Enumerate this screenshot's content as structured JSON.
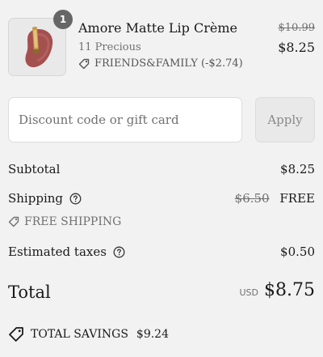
{
  "line_item": {
    "quantity": "1",
    "name": "Amore Matte Lip Crème",
    "variant": "11 Precious",
    "discount_label": "FRIENDS&FAMILY (-$2.74)",
    "original_price": "$10.99",
    "price": "$8.25",
    "image_icon": "lip-cream-product-icon"
  },
  "discount": {
    "placeholder": "Discount code or gift card",
    "apply_label": "Apply"
  },
  "summary": {
    "subtotal_label": "Subtotal",
    "subtotal_value": "$8.25",
    "shipping_label": "Shipping",
    "shipping_original": "$6.50",
    "shipping_value": "FREE",
    "free_shipping_label": "FREE SHIPPING",
    "taxes_label": "Estimated taxes",
    "taxes_value": "$0.50",
    "total_label": "Total",
    "currency": "USD",
    "total_value": "$8.75",
    "savings_label": "TOTAL SAVINGS",
    "savings_value": "$9.24"
  },
  "colors": {
    "background": "#f2f2f2",
    "text": "#1a1a1a",
    "muted": "#707070",
    "badge": "#666666"
  }
}
